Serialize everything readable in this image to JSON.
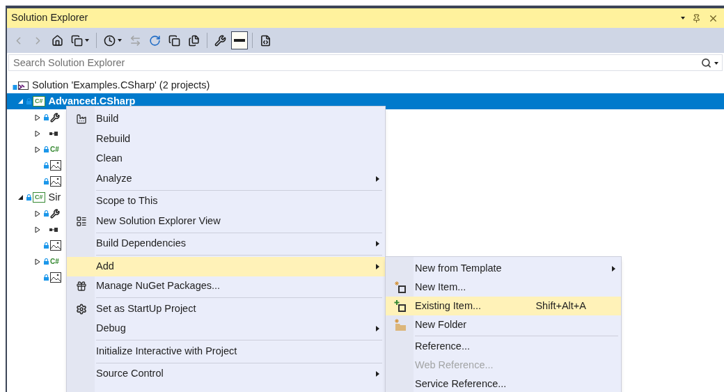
{
  "panel": {
    "title": "Solution Explorer"
  },
  "title_controls": [
    {
      "kind": "dropdown"
    },
    {
      "kind": "pin"
    },
    {
      "kind": "close"
    }
  ],
  "toolbar": [
    {
      "kind": "back",
      "disabled": true,
      "pressed": false,
      "dropdown": false
    },
    {
      "kind": "forward",
      "disabled": true,
      "pressed": false,
      "dropdown": false
    },
    {
      "kind": "home",
      "disabled": false,
      "pressed": false,
      "dropdown": false
    },
    {
      "kind": "switch-views",
      "disabled": false,
      "pressed": false,
      "dropdown": true
    },
    {
      "kind": "separator"
    },
    {
      "kind": "pending",
      "disabled": false,
      "pressed": false,
      "dropdown": true
    },
    {
      "kind": "sync",
      "disabled": true,
      "pressed": false,
      "dropdown": false
    },
    {
      "kind": "refresh",
      "disabled": false,
      "pressed": false,
      "dropdown": false
    },
    {
      "kind": "collapse",
      "disabled": false,
      "pressed": false,
      "dropdown": false
    },
    {
      "kind": "show-all",
      "disabled": false,
      "pressed": false,
      "dropdown": false
    },
    {
      "kind": "separator"
    },
    {
      "kind": "properties",
      "disabled": false,
      "pressed": false,
      "dropdown": false
    },
    {
      "kind": "preview",
      "disabled": false,
      "pressed": true,
      "dropdown": false
    },
    {
      "kind": "separator"
    },
    {
      "kind": "view-code",
      "disabled": false,
      "pressed": false,
      "dropdown": false
    }
  ],
  "search": {
    "placeholder": "Search Solution Explorer"
  },
  "tree": {
    "label": "Solution 'Examples.CSharp' (2 projects)",
    "kind": "solution",
    "children": [
      {
        "label": "Advanced.CSharp",
        "kind": "project",
        "badge": "C#",
        "selected": true,
        "expanded": true,
        "children": [
          {
            "kind": "properties",
            "expanded": false
          },
          {
            "kind": "references",
            "expanded": false
          },
          {
            "kind": "csharp-file",
            "badge": "C#",
            "expanded": false
          },
          {
            "kind": "image"
          },
          {
            "kind": "image"
          }
        ]
      },
      {
        "label": "Sir",
        "kind": "project",
        "badge": "C#",
        "selected": false,
        "expanded": true,
        "children": [
          {
            "kind": "properties",
            "expanded": false
          },
          {
            "kind": "references",
            "expanded": false
          },
          {
            "kind": "image"
          },
          {
            "kind": "csharp-file",
            "badge": "C#",
            "expanded": false
          },
          {
            "kind": "image"
          }
        ]
      }
    ]
  },
  "context_menu": [
    {
      "label": "Build",
      "kind": "build",
      "submenu": false,
      "selected": false
    },
    {
      "label": "Rebuild",
      "kind": "plain",
      "submenu": false,
      "selected": false
    },
    {
      "label": "Clean",
      "kind": "plain",
      "submenu": false,
      "selected": false
    },
    {
      "label": "Analyze",
      "kind": "plain",
      "submenu": true,
      "selected": false
    },
    {
      "kind": "separator"
    },
    {
      "label": "Scope to This",
      "kind": "plain",
      "submenu": false,
      "selected": false
    },
    {
      "label": "New Solution Explorer View",
      "kind": "new-view",
      "submenu": false,
      "selected": false
    },
    {
      "kind": "separator"
    },
    {
      "label": "Build Dependencies",
      "kind": "plain",
      "submenu": true,
      "selected": false
    },
    {
      "kind": "separator"
    },
    {
      "label": "Add",
      "kind": "plain",
      "submenu": true,
      "selected": true
    },
    {
      "label": "Manage NuGet Packages...",
      "kind": "package",
      "submenu": false,
      "selected": false
    },
    {
      "kind": "separator"
    },
    {
      "label": "Set as StartUp Project",
      "kind": "gear",
      "submenu": false,
      "selected": false
    },
    {
      "label": "Debug",
      "kind": "plain",
      "submenu": true,
      "selected": false
    },
    {
      "kind": "separator"
    },
    {
      "label": "Initialize Interactive with Project",
      "kind": "plain",
      "submenu": false,
      "selected": false
    },
    {
      "kind": "separator"
    },
    {
      "label": "Source Control",
      "kind": "plain",
      "submenu": true,
      "selected": false
    }
  ],
  "add_submenu": [
    {
      "label": "New from Template",
      "kind": "plain",
      "submenu": true,
      "selected": false,
      "disabled": false
    },
    {
      "label": "New Item...",
      "kind": "new-item",
      "submenu": false,
      "selected": false,
      "disabled": false
    },
    {
      "label": "Existing Item...",
      "kind": "existing-item",
      "shortcut": "Shift+Alt+A",
      "submenu": false,
      "selected": true,
      "disabled": false
    },
    {
      "label": "New Folder",
      "kind": "new-folder",
      "submenu": false,
      "selected": false,
      "disabled": false
    },
    {
      "kind": "separator"
    },
    {
      "label": "Reference...",
      "kind": "plain",
      "submenu": false,
      "selected": false,
      "disabled": false
    },
    {
      "label": "Web Reference...",
      "kind": "plain",
      "submenu": false,
      "selected": false,
      "disabled": true
    },
    {
      "label": "Service Reference...",
      "kind": "plain",
      "submenu": false,
      "selected": false,
      "disabled": false
    }
  ]
}
